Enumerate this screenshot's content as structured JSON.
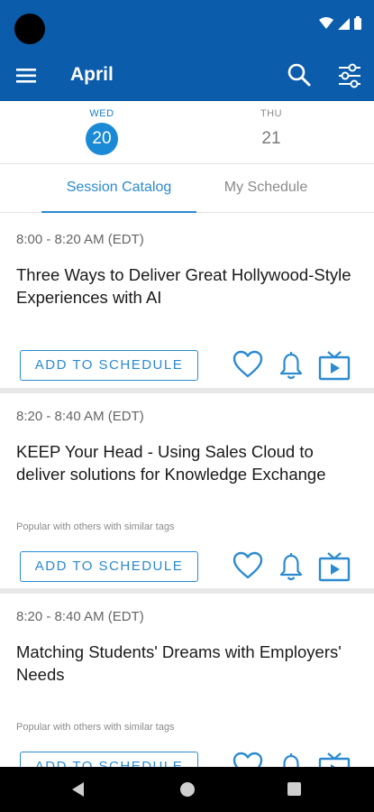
{
  "app_bar": {
    "title": "April",
    "menu_icon": "hamburger-menu-icon",
    "search_icon": "search-icon",
    "filter_icon": "filter-sliders-icon"
  },
  "status_bar": {
    "icons": [
      "wifi-icon",
      "signal-icon",
      "battery-icon"
    ]
  },
  "days": [
    {
      "name": "WED",
      "number": "20",
      "selected": true
    },
    {
      "name": "THU",
      "number": "21",
      "selected": false
    }
  ],
  "tabs": [
    {
      "label": "Session Catalog",
      "active": true
    },
    {
      "label": "My Schedule",
      "active": false
    }
  ],
  "sessions": [
    {
      "time": "8:00 - 8:20 AM (EDT)",
      "title": "Three Ways to Deliver Great Hollywood-Style Experiences with AI",
      "note": "",
      "add_label": "ADD TO SCHEDULE"
    },
    {
      "time": "8:20 - 8:40 AM (EDT)",
      "title": "KEEP Your Head - Using Sales Cloud to deliver solutions for Knowledge Exchange",
      "note": "Popular with others with similar tags",
      "add_label": "ADD TO SCHEDULE"
    },
    {
      "time": "8:20 - 8:40 AM (EDT)",
      "title": "Matching Students' Dreams with Employers' Needs",
      "note": "Popular with others with similar tags",
      "add_label": "ADD TO SCHEDULE"
    }
  ],
  "session_action_icons": [
    "heart-icon",
    "bell-icon",
    "video-icon"
  ],
  "nav_bar": {
    "icons": [
      "back-icon",
      "home-icon",
      "recents-icon"
    ]
  },
  "colors": {
    "primary": "#0b5cab",
    "accent": "#2b8ad0",
    "selected_day": "#1a8ad6"
  }
}
